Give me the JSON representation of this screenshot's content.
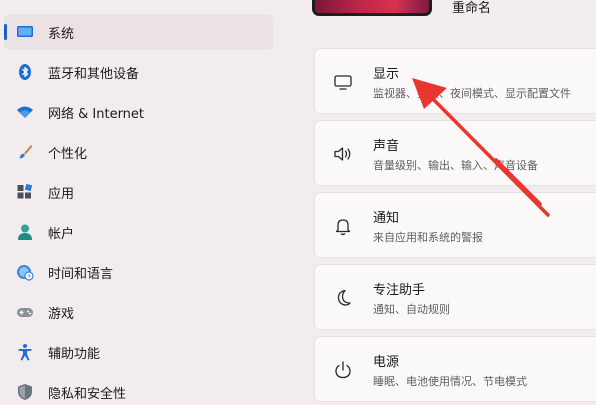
{
  "sidebar": {
    "items": [
      {
        "label": "系统",
        "icon": "monitor-icon",
        "selected": true
      },
      {
        "label": "蓝牙和其他设备",
        "icon": "bluetooth-icon"
      },
      {
        "label": "网络 & Internet",
        "icon": "wifi-icon"
      },
      {
        "label": "个性化",
        "icon": "brush-icon"
      },
      {
        "label": "应用",
        "icon": "apps-icon"
      },
      {
        "label": "帐户",
        "icon": "person-icon"
      },
      {
        "label": "时间和语言",
        "icon": "globe-clock-icon"
      },
      {
        "label": "游戏",
        "icon": "gamepad-icon"
      },
      {
        "label": "辅助功能",
        "icon": "accessibility-icon"
      },
      {
        "label": "隐私和安全性",
        "icon": "shield-icon"
      }
    ]
  },
  "header": {
    "rename_label": "重命名"
  },
  "cards": [
    {
      "title": "显示",
      "subtitle": "监视器、亮度、夜间模式、显示配置文件",
      "icon": "display-icon"
    },
    {
      "title": "声音",
      "subtitle": "音量级别、输出、输入、声音设备",
      "icon": "speaker-icon"
    },
    {
      "title": "通知",
      "subtitle": "来自应用和系统的警报",
      "icon": "bell-icon"
    },
    {
      "title": "专注助手",
      "subtitle": "通知、自动规则",
      "icon": "moon-icon"
    },
    {
      "title": "电源",
      "subtitle": "睡眠、电池使用情况、节电模式",
      "icon": "power-icon"
    }
  ],
  "colors": {
    "accent": "#1f5fbf",
    "annotation": "#e8372f",
    "background": "#f3ecef",
    "card": "#fbf8f9"
  }
}
